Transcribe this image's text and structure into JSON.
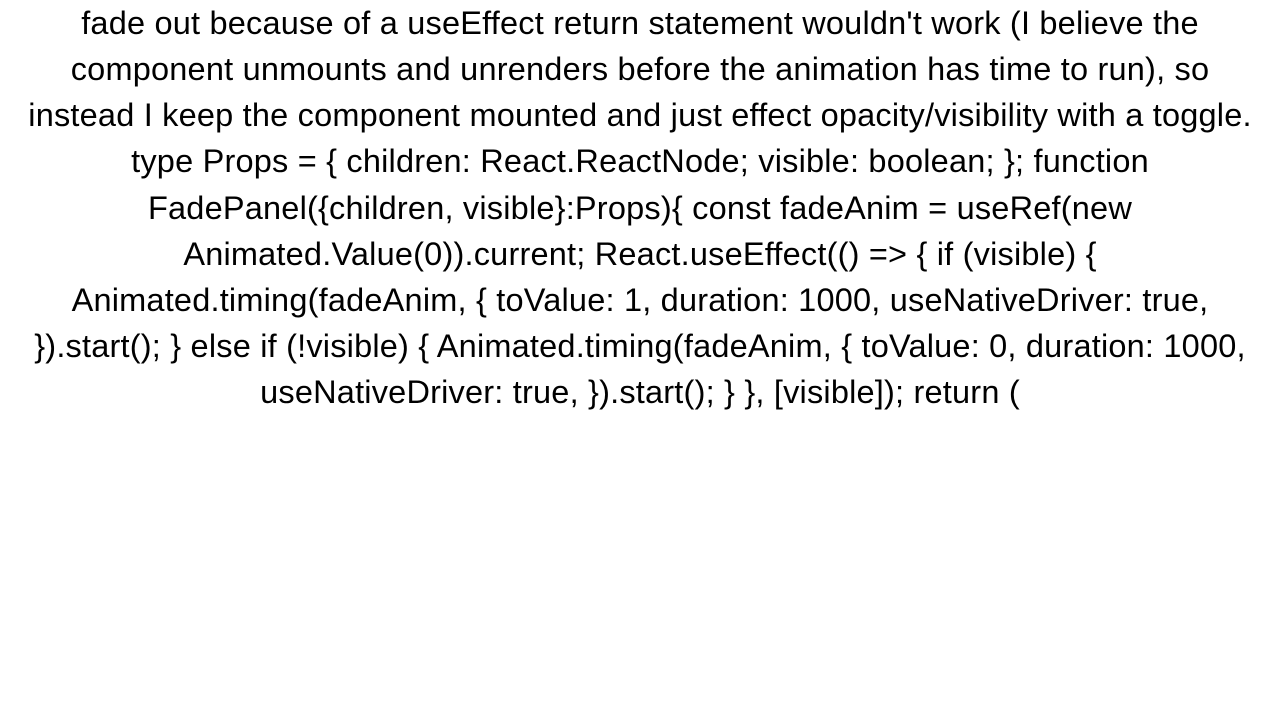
{
  "paragraph": {
    "text": "fade out because of a useEffect return statement wouldn't work (I believe the component unmounts and unrenders before the animation has time to run), so instead I keep the component mounted and just effect opacity/visibility with a toggle. type Props = {   children: React.ReactNode;   visible: boolean; };  function FadePanel({children, visible}:Props){   const fadeAnim = useRef(new Animated.Value(0)).current;   React.useEffect(() => {     if (visible) {       Animated.timing(fadeAnim, {         toValue: 1,         duration: 1000,         useNativeDriver: true,       }).start();     } else if (!visible) {       Animated.timing(fadeAnim, {         toValue: 0,         duration: 1000,         useNativeDriver: true,       }).start();     }   }, [visible]);   return ("
  }
}
